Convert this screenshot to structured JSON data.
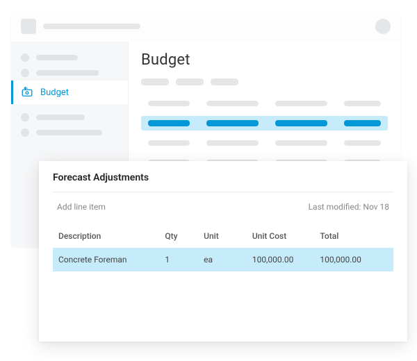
{
  "sidebar": {
    "active_label": "Budget"
  },
  "main": {
    "title": "Budget"
  },
  "forecast": {
    "title": "Forecast Adjustments",
    "add_line": "Add line item",
    "last_modified": "Last modified: Nov 18",
    "columns": {
      "description": "Description",
      "qty": "Qty",
      "unit": "Unit",
      "unit_cost": "Unit Cost",
      "total": "Total"
    },
    "rows": [
      {
        "description": "Concrete Foreman",
        "qty": "1",
        "unit": "ea",
        "unit_cost": "100,000.00",
        "total": "100,000.00"
      }
    ]
  }
}
